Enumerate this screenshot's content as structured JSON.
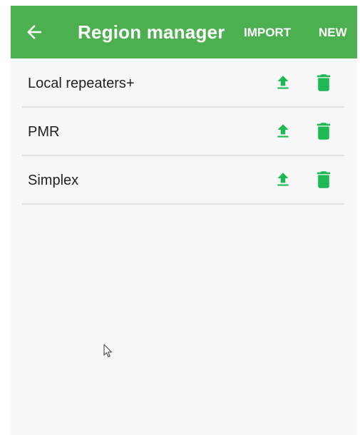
{
  "app_bar": {
    "title": "Region manager",
    "back_icon": "arrow-back-icon",
    "actions": {
      "import_label": "IMPORT",
      "new_label": "NEW"
    }
  },
  "regions": [
    {
      "name": "Local repeaters+",
      "upload_icon": "upload-icon",
      "delete_icon": "trash-icon"
    },
    {
      "name": "PMR",
      "upload_icon": "upload-icon",
      "delete_icon": "trash-icon"
    },
    {
      "name": "Simplex",
      "upload_icon": "upload-icon",
      "delete_icon": "trash-icon"
    }
  ],
  "colors": {
    "app_bar": "#4caf50",
    "icon_accent": "#1db954",
    "background": "#f7f7f7",
    "divider": "#e2e2e2"
  }
}
